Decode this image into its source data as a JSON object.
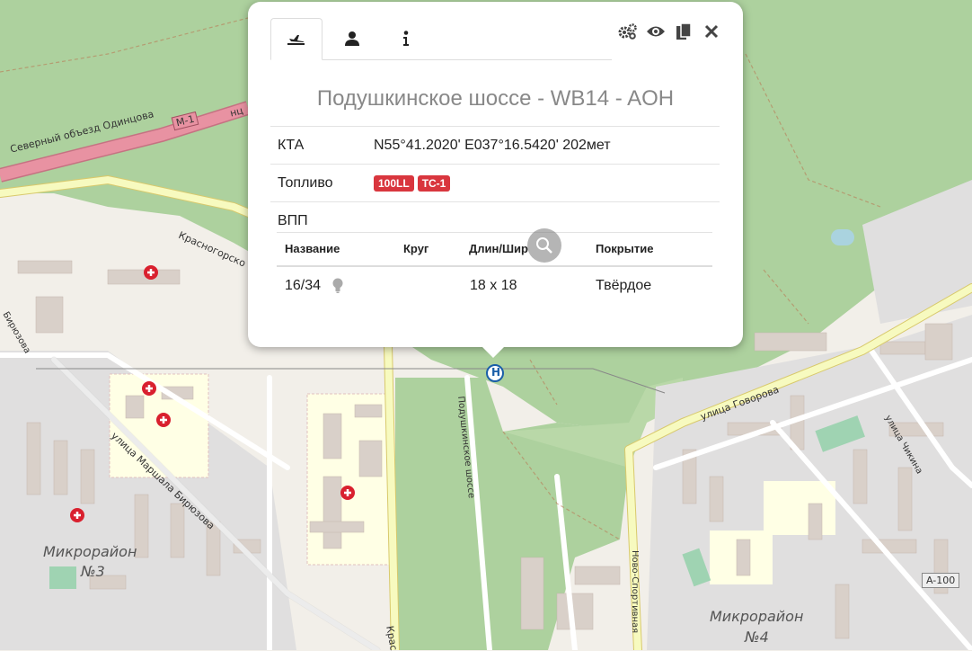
{
  "map": {
    "roads": {
      "m1_shield": "M-1",
      "m1_partial": "нц",
      "a100_shield": "A-100",
      "severny": "Северный объезд Одинцова",
      "krasnogorskoe": "Красногорско",
      "krasnogorskoe_bottom": "Крас",
      "biryuzova_top": "Бирюзова",
      "marshala_biryuzova": "улица Маршала Бирюзова",
      "podushkinskoe": "Подушкинское шоссе",
      "govorova": "улица Говорова",
      "chikina": "улица Чикина",
      "novo_sportivnaya": "Ново-Спортивная"
    },
    "districts": {
      "mkr3_line1": "Микрорайон",
      "mkr3_line2": "№3",
      "mkr4_line1": "Микрорайон",
      "mkr4_line2": "№4"
    },
    "helipad_symbol": "H"
  },
  "popup": {
    "tabs": [
      {
        "icon": "plane-icon",
        "active": true
      },
      {
        "icon": "user-icon",
        "active": false
      },
      {
        "icon": "info-icon",
        "active": false
      }
    ],
    "tools": [
      "settings-icon",
      "eye-icon",
      "copy-icon",
      "close-icon"
    ],
    "title": "Подушкинское шоссе - WB14 - AOH",
    "kta": {
      "label": "КТА",
      "value": "N55°41.2020' E037°16.5420' 202мет"
    },
    "fuel": {
      "label": "Топливо",
      "badges": [
        "100LL",
        "TC-1"
      ]
    },
    "runway": {
      "label": "ВПП",
      "headers": [
        "Название",
        "Круг",
        "Длин/Шир",
        "Покрытие"
      ],
      "rows": [
        {
          "name": "16/34",
          "circuit": "",
          "dims": "18 x 18",
          "surface": "Твёрдое"
        }
      ]
    }
  },
  "colors": {
    "forest": "#add19e",
    "residential": "#e0dfdf",
    "hospital": "#ffffe5",
    "background": "#f2efe9",
    "road_yellow": "#f7fabf",
    "road_orange": "#fcd6a4",
    "motorway": "#e892a2",
    "badge_red": "#d9363e",
    "title_gray": "#888888"
  }
}
